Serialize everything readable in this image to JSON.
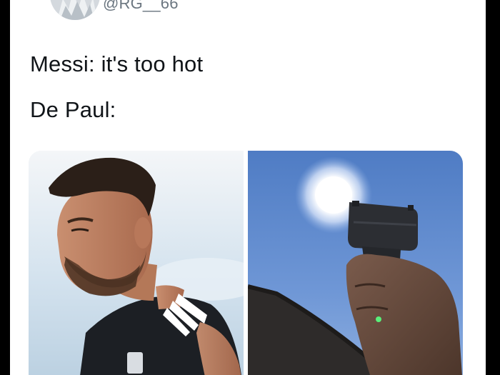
{
  "tweet": {
    "handle": "@RG__66",
    "lines": [
      "Messi: it's too hot",
      "De Paul:"
    ]
  },
  "media": {
    "left_image": "soccer-player-photo",
    "right_image": "hand-aiming-pistol-at-sun-photo"
  },
  "colors": {
    "background": "#000000",
    "card": "#ffffff",
    "text": "#101418",
    "handle": "#6b7680",
    "sky_left": "#cfe0ee",
    "sky_right": "#5f87c9"
  }
}
